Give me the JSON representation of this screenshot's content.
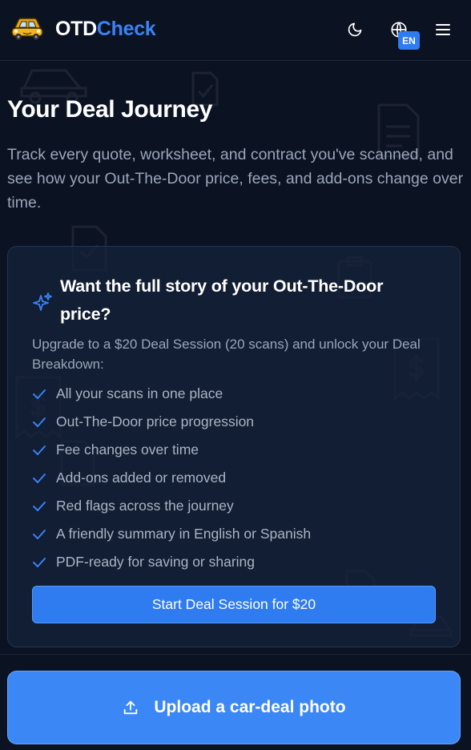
{
  "header": {
    "brand_part1": "OTD",
    "brand_part2": "Check",
    "logo_icon": "car-logo-icon",
    "theme_toggle_icon": "moon-icon",
    "language_icon": "globe-icon",
    "language_code": "EN",
    "menu_icon": "hamburger-menu-icon"
  },
  "page": {
    "title": "Your Deal Journey",
    "description": "Track every quote, worksheet, and contract you've scanned, and see how your Out-The-Door price, fees, and add-ons change over time."
  },
  "upsell": {
    "icon": "sparkle-icon",
    "title": "Want the full story of your Out-The-Door price?",
    "description": "Upgrade to a $20 Deal Session (20 scans) and unlock your Deal Breakdown:",
    "features": [
      "All your scans in one place",
      "Out-The-Door price progression",
      "Fee changes over time",
      "Add-ons added or removed",
      "Red flags across the journey",
      "A friendly summary in English or Spanish",
      "PDF-ready for saving or sharing"
    ],
    "cta_label": "Start Deal Session for $20"
  },
  "upload": {
    "icon": "upload-icon",
    "label": "Upload a car-deal photo"
  },
  "colors": {
    "background": "#0b1222",
    "accent": "#3b82f6",
    "card_bg": "#15233a",
    "muted_text": "#9aa6b8"
  }
}
